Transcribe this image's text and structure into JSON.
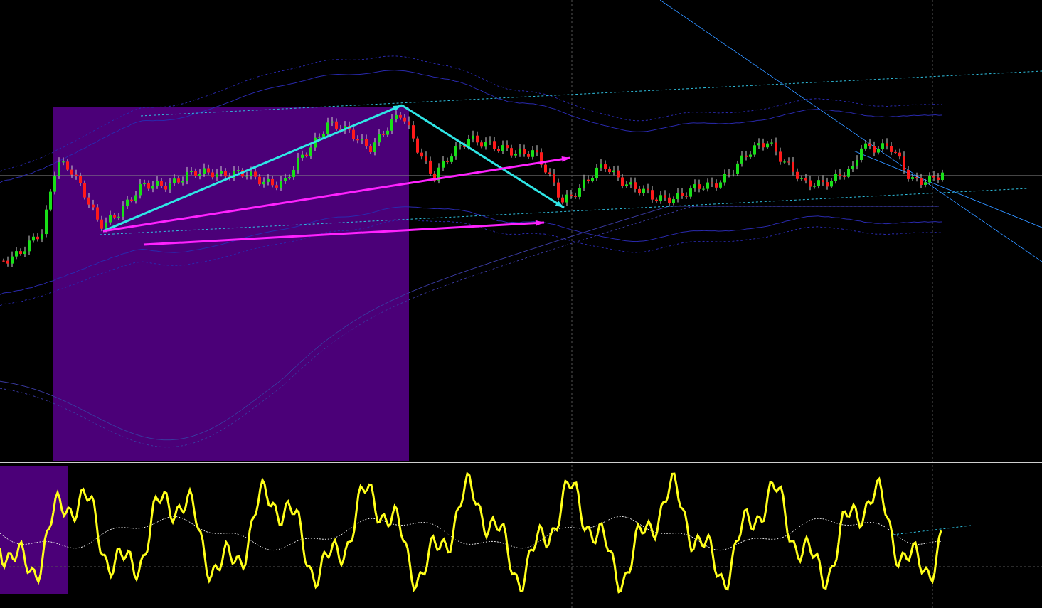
{
  "price_chart": {
    "highlighted_range": true
  },
  "oscillator": {
    "highlighted_range": true
  }
}
